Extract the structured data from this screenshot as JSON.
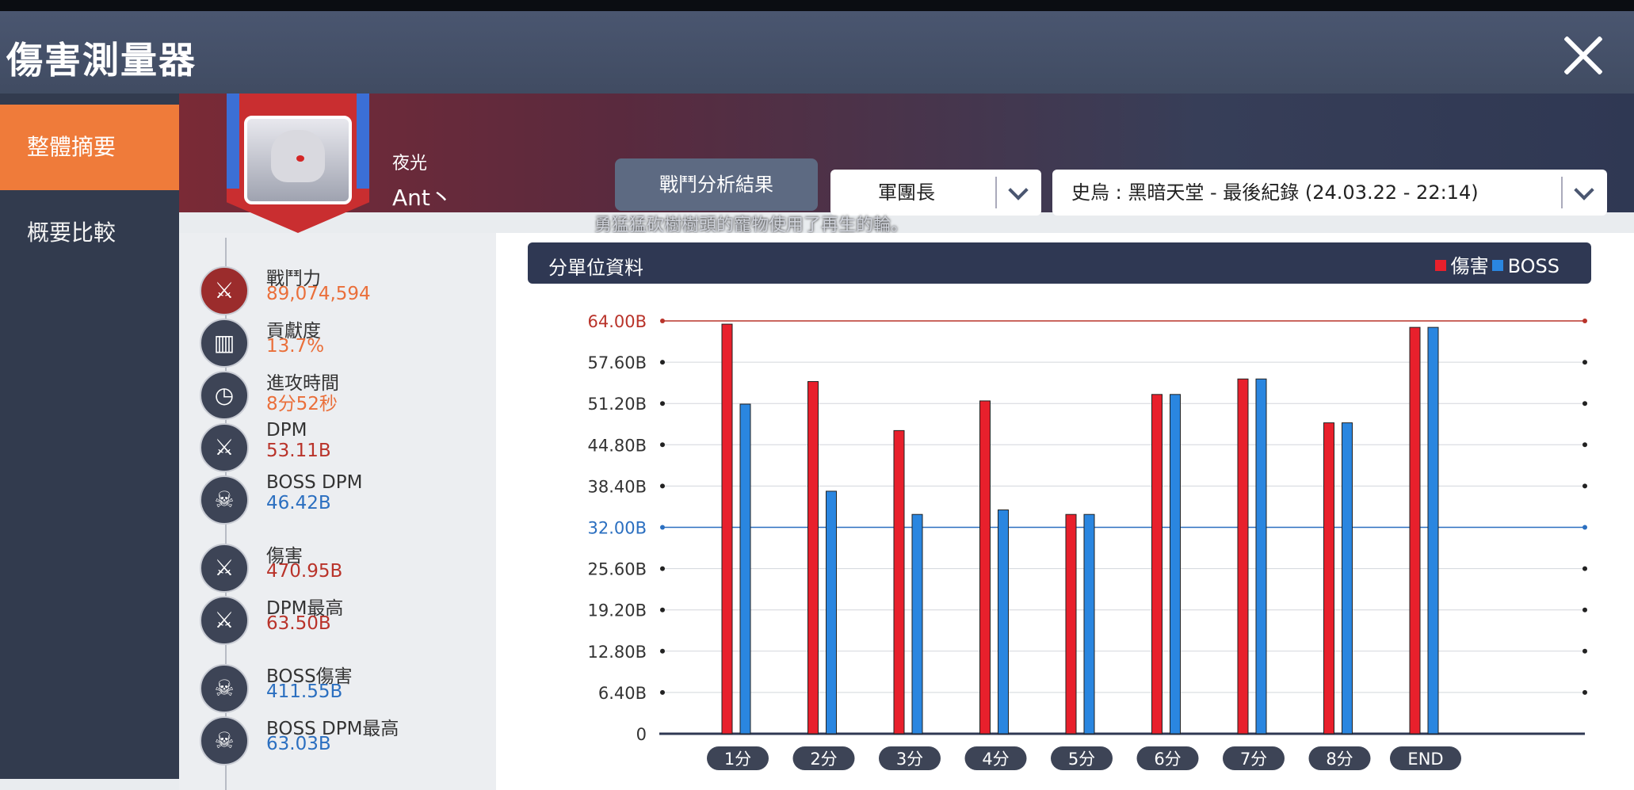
{
  "window": {
    "title": "傷害測量器"
  },
  "sidebar": {
    "items": [
      {
        "label": "整體摘要"
      },
      {
        "label": "概要比較"
      }
    ]
  },
  "character": {
    "class": "夜光",
    "name": "Ant丶"
  },
  "controls": {
    "analysis_button": "戰鬥分析結果",
    "role_select": "軍團長",
    "record_select": "史烏 : 黑暗天堂 - 最後紀錄 (24.03.22 - 22:14)"
  },
  "notice": "勇猛猛砍樹樹頭的寵物使用了再生的輪。",
  "stats": [
    {
      "label": "戰鬥力",
      "value": "89,074,594",
      "color": "orange",
      "icon": "crossed-swords-icon"
    },
    {
      "label": "貢獻度",
      "value": "13.7%",
      "color": "orange",
      "icon": "bar-chart-icon"
    },
    {
      "label": "進攻時間",
      "value": "8分52秒",
      "color": "orange",
      "icon": "clock-icon"
    },
    {
      "label": "DPM",
      "value": "53.11B",
      "color": "red",
      "icon": "sword-icon"
    },
    {
      "label": "BOSS DPM",
      "value": "46.42B",
      "color": "blue",
      "icon": "skull-icon"
    },
    {
      "label": "傷害",
      "value": "470.95B",
      "color": "red",
      "icon": "sword-icon"
    },
    {
      "label": "DPM最高",
      "value": "63.50B",
      "color": "red",
      "icon": "sword-up-icon"
    },
    {
      "label": "BOSS傷害",
      "value": "411.55B",
      "color": "blue",
      "icon": "skull-icon"
    },
    {
      "label": "BOSS DPM最高",
      "value": "63.03B",
      "color": "blue",
      "icon": "skull-up-icon"
    }
  ],
  "chart_panel": {
    "title": "分單位資料"
  },
  "colors": {
    "damage": "#e8202c",
    "boss": "#2a86e0",
    "orange": "#ea6f3a",
    "red": "#b9332a",
    "blue": "#2b6fc0"
  },
  "chart_data": {
    "type": "bar",
    "categories": [
      "1分",
      "2分",
      "3分",
      "4分",
      "5分",
      "6分",
      "7分",
      "8分",
      "END"
    ],
    "series": [
      {
        "name": "傷害",
        "values": [
          63.5,
          54.6,
          47.0,
          51.6,
          34.0,
          52.6,
          55.0,
          48.2,
          63.0
        ]
      },
      {
        "name": "BOSS",
        "values": [
          51.1,
          37.6,
          34.0,
          34.7,
          34.0,
          52.6,
          55.0,
          48.2,
          63.0
        ]
      }
    ],
    "yticks": [
      "0",
      "6.40B",
      "12.80B",
      "19.20B",
      "25.60B",
      "32.00B",
      "38.40B",
      "44.80B",
      "51.20B",
      "57.60B",
      "64.00B"
    ],
    "ylim": [
      0,
      64
    ],
    "reference_lines": [
      {
        "value": 64.0,
        "color": "red"
      },
      {
        "value": 32.0,
        "color": "blue"
      }
    ],
    "grid": true,
    "legend_position": "top-right"
  }
}
